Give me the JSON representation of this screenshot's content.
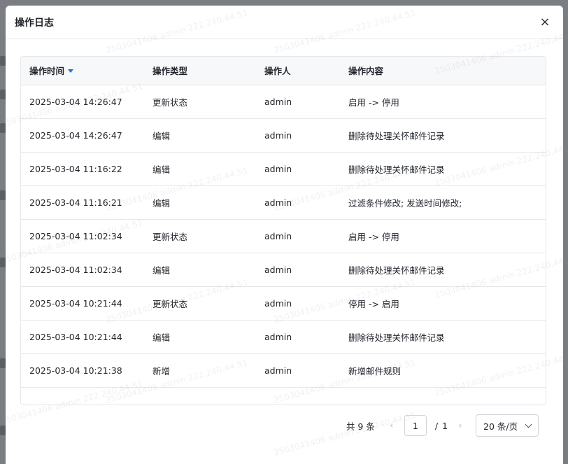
{
  "dialog": {
    "title": "操作日志",
    "close_glyph": "×"
  },
  "table": {
    "columns": [
      "操作时间",
      "操作类型",
      "操作人",
      "操作内容"
    ],
    "sorted_column": "操作时间",
    "sort_direction": "descending",
    "rows": [
      [
        "2025-03-04 14:26:47",
        "更新状态",
        "admin",
        "启用 -> 停用"
      ],
      [
        "2025-03-04 14:26:47",
        "编辑",
        "admin",
        "删除待处理关怀邮件记录"
      ],
      [
        "2025-03-04 11:16:22",
        "编辑",
        "admin",
        "删除待处理关怀邮件记录"
      ],
      [
        "2025-03-04 11:16:21",
        "编辑",
        "admin",
        "过滤条件修改; 发送时间修改;"
      ],
      [
        "2025-03-04 11:02:34",
        "更新状态",
        "admin",
        "启用 -> 停用"
      ],
      [
        "2025-03-04 11:02:34",
        "编辑",
        "admin",
        "删除待处理关怀邮件记录"
      ],
      [
        "2025-03-04 10:21:44",
        "更新状态",
        "admin",
        "停用 -> 启用"
      ],
      [
        "2025-03-04 10:21:44",
        "编辑",
        "admin",
        "删除待处理关怀邮件记录"
      ],
      [
        "2025-03-04 10:21:38",
        "新增",
        "admin",
        "新增邮件规则"
      ]
    ]
  },
  "pagination": {
    "total_label": "共 9 条",
    "prev_glyph": "‹",
    "current_page": "1",
    "separator": "/",
    "total_pages": "1",
    "next_glyph": "›",
    "page_size": "20 条/页"
  },
  "watermark_text": "2503041406 admin 222.240.44.51",
  "colors": {
    "sort_accent": "#1a6ce8",
    "overlay": "#7a7d82"
  }
}
